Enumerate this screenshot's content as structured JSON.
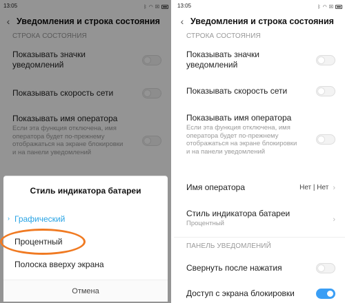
{
  "left": {
    "status": {
      "time": "13:05"
    },
    "header": {
      "title": "Уведомления и строка состояния"
    },
    "section_status": "СТРОКА СОСТОЯНИЯ",
    "items": [
      {
        "label": "Показывать значки уведомлений"
      },
      {
        "label": "Показывать скорость сети"
      },
      {
        "label": "Показывать имя оператора",
        "desc": "Если эта функция отключена, имя оператора будет по-прежнему отображаться на экране блокировки и на панели уведомлений"
      }
    ],
    "dialog": {
      "title": "Стиль индикатора батареи",
      "options": [
        "Графический",
        "Процентный",
        "Полоска вверху экрана"
      ],
      "selected_index": 0,
      "cancel": "Отмена"
    }
  },
  "right": {
    "status": {
      "time": "13:05"
    },
    "header": {
      "title": "Уведомления и строка состояния"
    },
    "section_status": "СТРОКА СОСТОЯНИЯ",
    "items": [
      {
        "label": "Показывать значки уведомлений"
      },
      {
        "label": "Показывать скорость сети"
      },
      {
        "label": "Показывать имя оператора",
        "desc": "Если эта функция отключена, имя оператора будет по-прежнему отображаться на экране блокировки и на панели уведомлений"
      },
      {
        "label": "Имя оператора",
        "value": "Нет | Нет"
      },
      {
        "label": "Стиль индикатора батареи",
        "desc": "Процентный"
      }
    ],
    "section_panel": "ПАНЕЛЬ УВЕДОМЛЕНИЙ",
    "panel_items": [
      {
        "label": "Свернуть после нажатия"
      },
      {
        "label": "Доступ с экрана блокировки"
      }
    ]
  },
  "colors": {
    "accent": "#3a9ef5",
    "highlight": "#f07a22",
    "selected_option": "#27a3e4"
  }
}
